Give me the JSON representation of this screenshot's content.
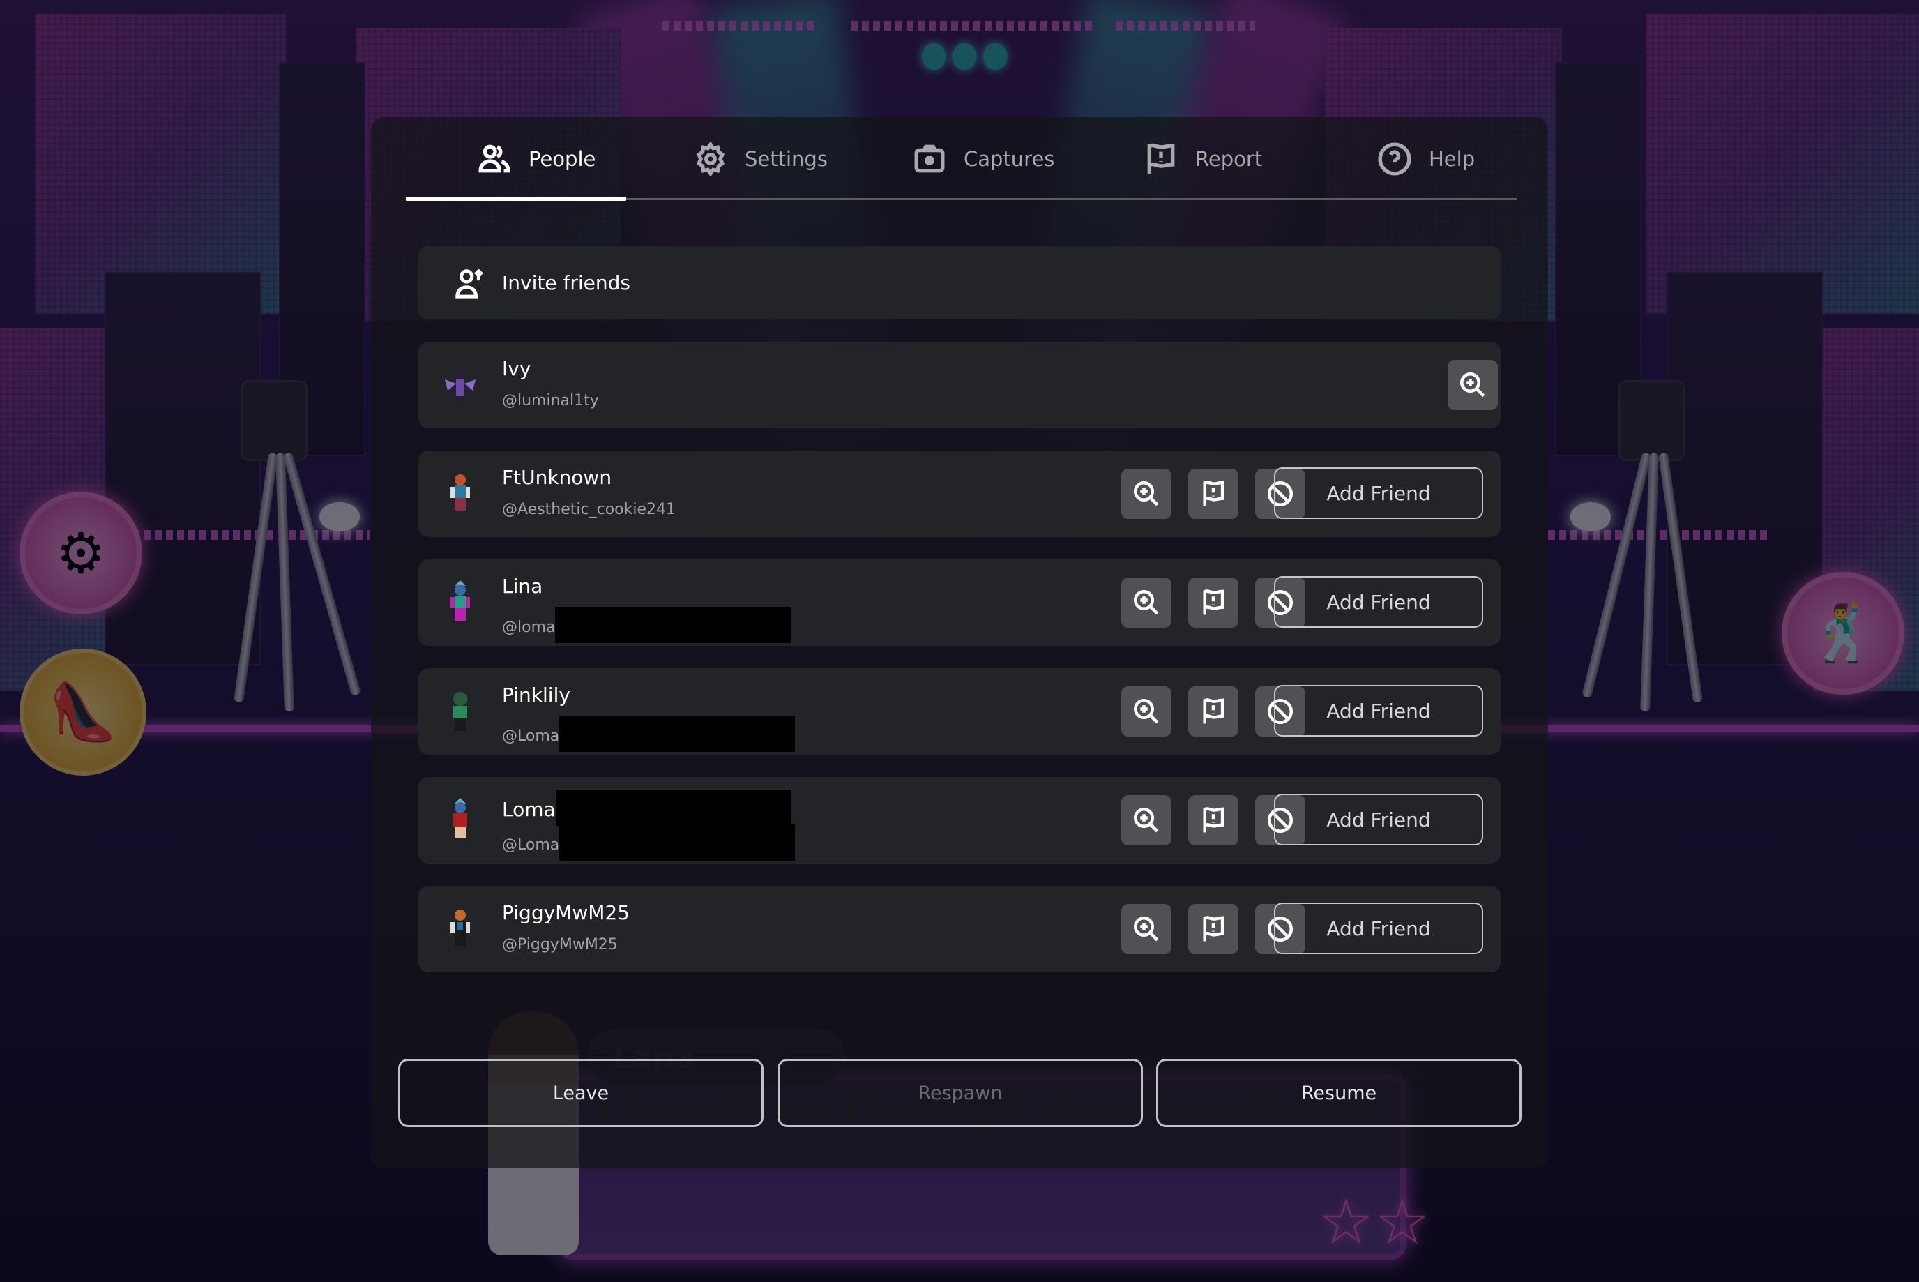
{
  "tabs": [
    {
      "label": "People",
      "icon": "people-icon",
      "active": true
    },
    {
      "label": "Settings",
      "icon": "gear-icon",
      "active": false
    },
    {
      "label": "Captures",
      "icon": "camera-icon",
      "active": false
    },
    {
      "label": "Report",
      "icon": "report-flag-icon",
      "active": false
    },
    {
      "label": "Help",
      "icon": "help-icon",
      "active": false
    }
  ],
  "invite": {
    "label": "Invite friends",
    "icon": "invite-friend-icon"
  },
  "players": [
    {
      "name": "Ivy",
      "handle": "@luminal1ty",
      "is_self": true
    },
    {
      "name": "FtUnknown",
      "handle": "@Aesthetic_cookie241",
      "add_label": "Add Friend"
    },
    {
      "name": "Lina",
      "handle": "@loma",
      "handle_redacted": true,
      "add_label": "Add Friend"
    },
    {
      "name": "Pinklily",
      "handle": "@Loma",
      "handle_redacted": true,
      "add_label": "Add Friend"
    },
    {
      "name": "Loma",
      "name_redacted": true,
      "handle": "@Loma",
      "handle_redacted": true,
      "add_label": "Add Friend"
    },
    {
      "name": "PiggyMwM25",
      "handle": "@PiggyMwM25",
      "add_label": "Add Friend"
    }
  ],
  "row_actions": [
    "inspect-icon",
    "report-flag-icon",
    "block-icon"
  ],
  "footer": {
    "leave": "Leave",
    "respawn": "Respawn",
    "respawn_disabled": true,
    "resume": "Resume"
  },
  "game": {
    "dialog_speaker": "Lana",
    "dialog_text": "LomansSr and Lomansjr, I have some bad news..."
  },
  "colors": {
    "panel_bg": "#141418",
    "row_bg": "#232427",
    "icon_btn_bg": "#505154",
    "active_tab": "#ffffff",
    "inactive_tab": "#a8a8ad"
  }
}
